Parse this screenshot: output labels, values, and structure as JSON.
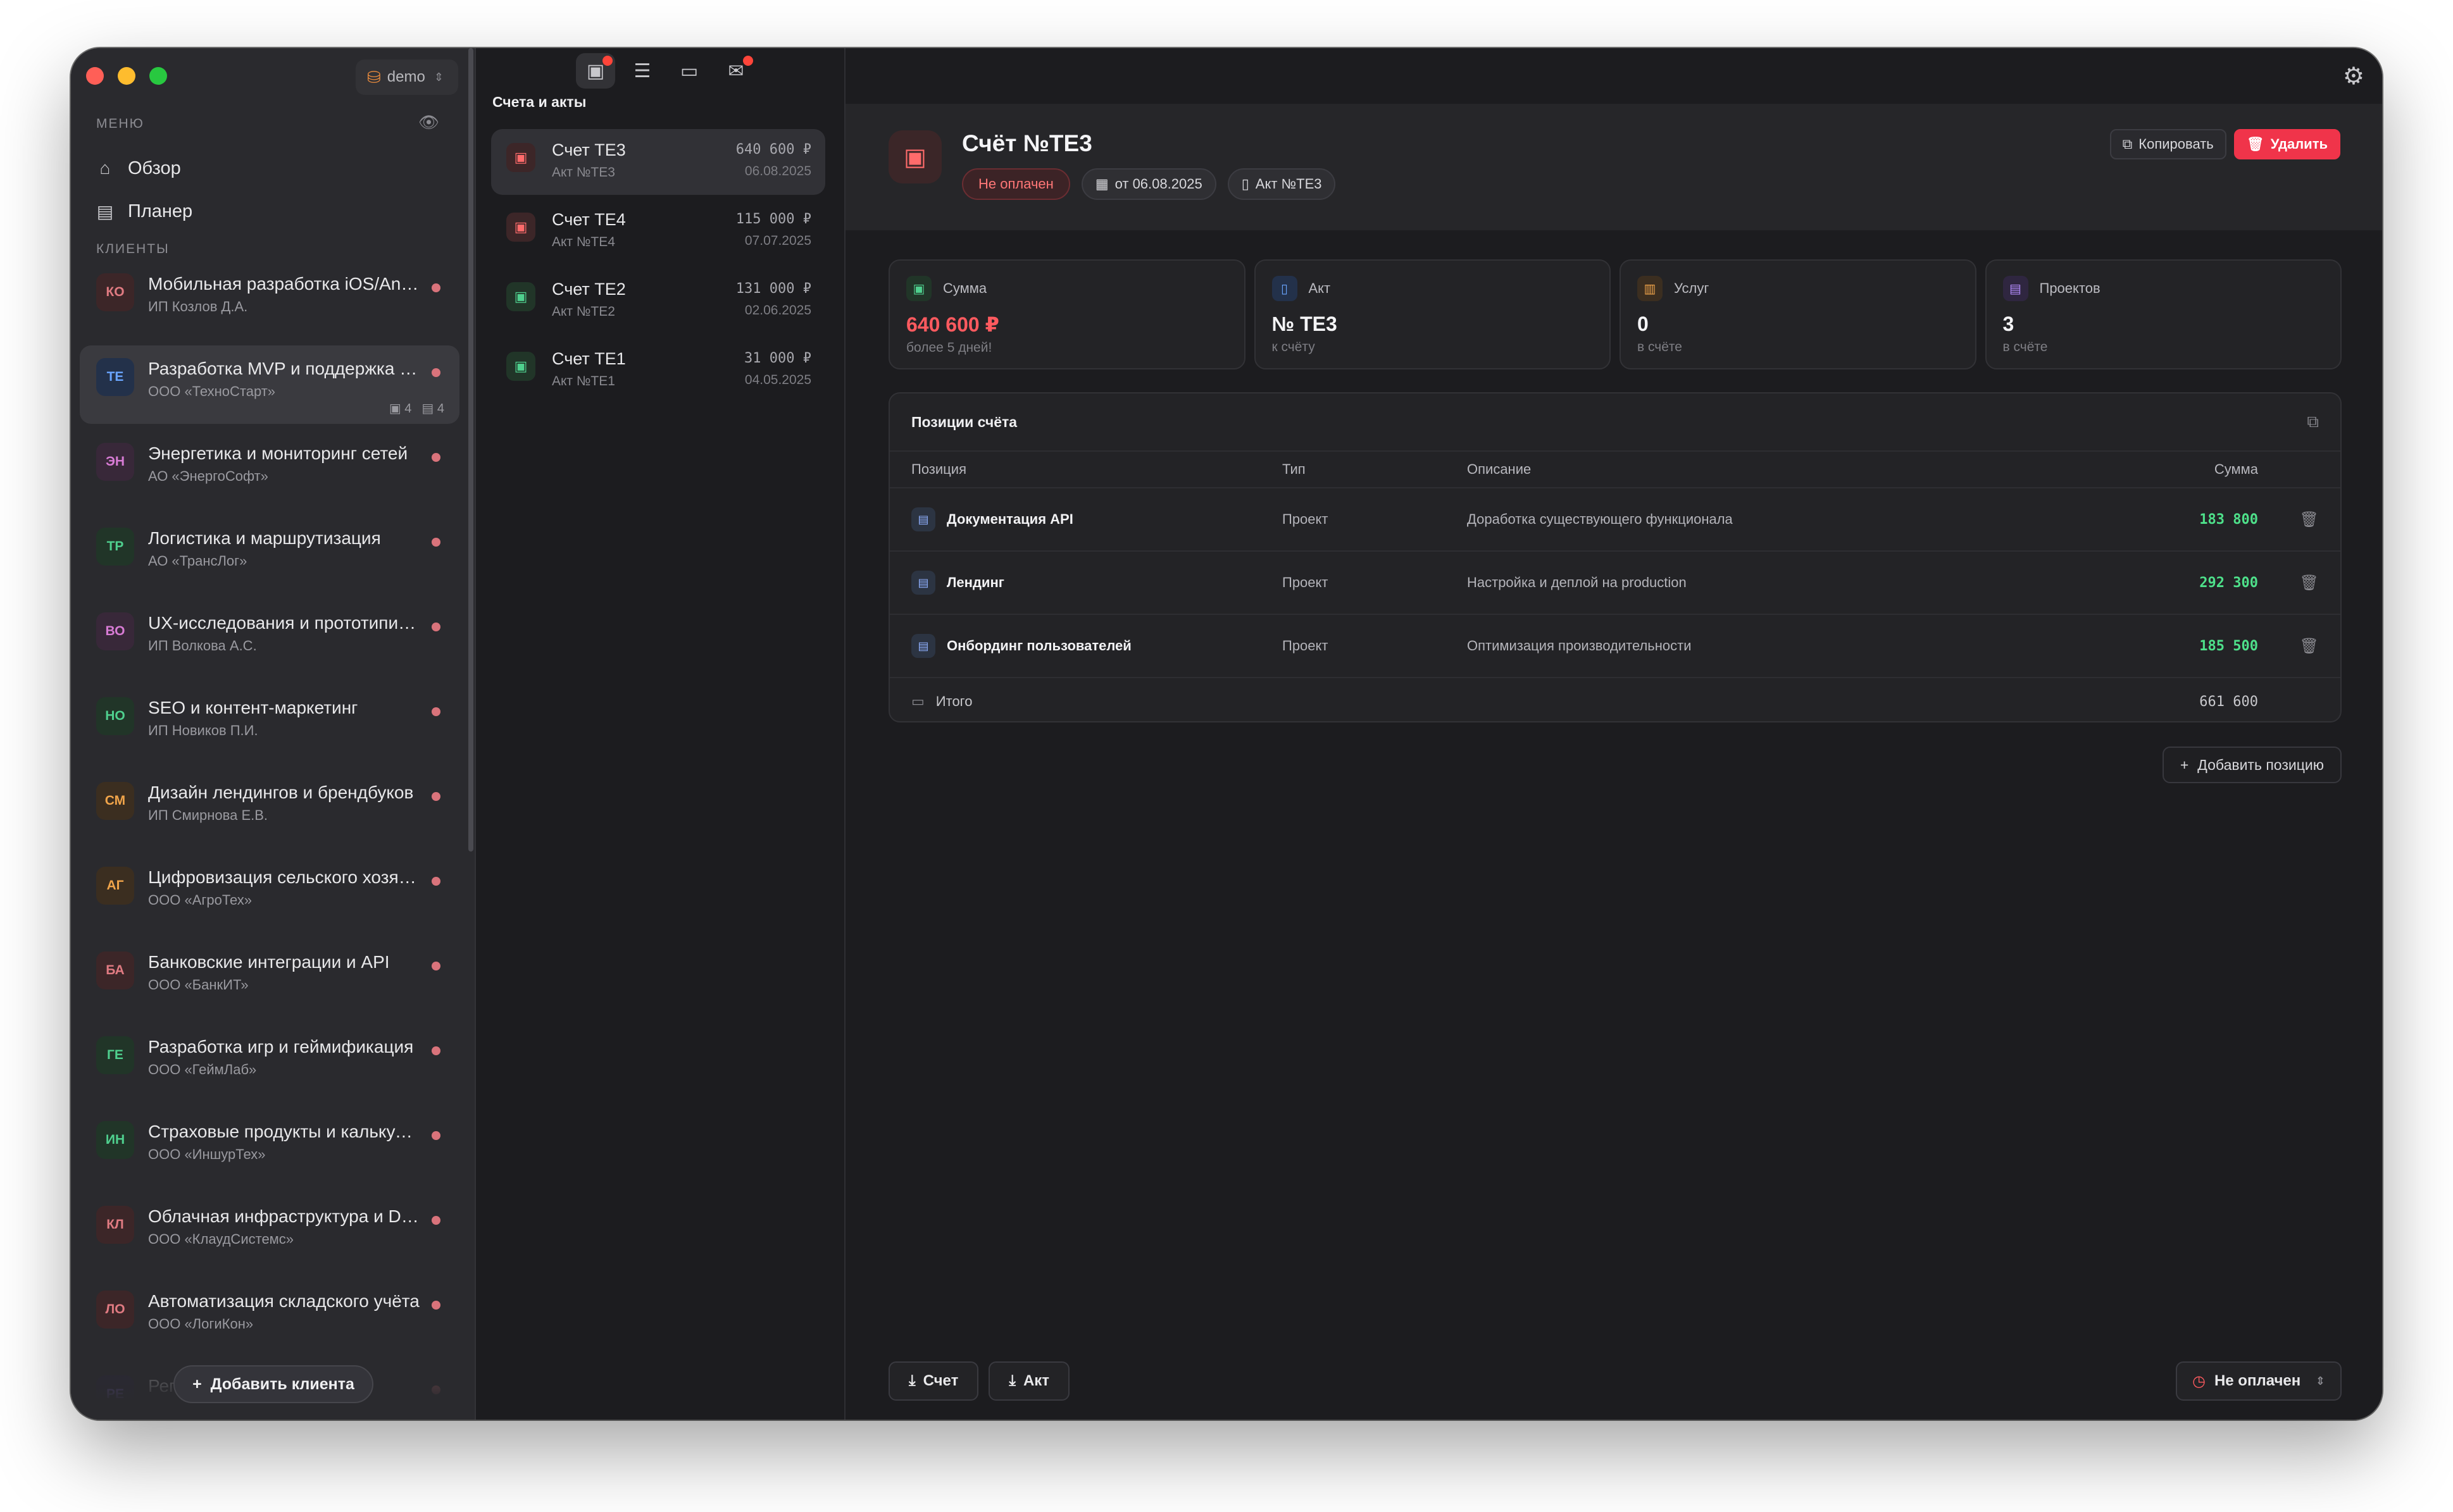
{
  "colors": {
    "accent_red": "#f0344a",
    "money_green": "#4ee08a",
    "dot": "#d9737b"
  },
  "sidebar": {
    "workspace": "demo",
    "menu_label": "МЕНЮ",
    "clients_label": "КЛИЕНТЫ",
    "nav": [
      {
        "label": "Обзор",
        "icon": "home-icon"
      },
      {
        "label": "Планер",
        "icon": "planner-icon"
      }
    ],
    "clients": [
      {
        "initials": "КО",
        "name": "Мобильная разработка iOS/Android",
        "org": "ИП Козлов Д.А.",
        "color": "#e07b82",
        "bg": "#3c2628"
      },
      {
        "initials": "ТЕ",
        "name": "Разработка MVP и поддержка платформы",
        "org": "ООО «ТехноСтарт»",
        "color": "#6aa5ff",
        "bg": "#23314a",
        "active": true,
        "invoices": "4",
        "projects": "4"
      },
      {
        "initials": "ЭН",
        "name": "Энергетика и мониторинг сетей",
        "org": "АО «ЭнергоСофт»",
        "color": "#d77bd4",
        "bg": "#382839"
      },
      {
        "initials": "ТР",
        "name": "Логистика и маршрутизация",
        "org": "АО «ТрансЛог»",
        "color": "#4fd08e",
        "bg": "#213528"
      },
      {
        "initials": "ВО",
        "name": "UX-исследования и прототипирование",
        "org": "ИП Волкова А.С.",
        "color": "#d77bd4",
        "bg": "#382839"
      },
      {
        "initials": "НО",
        "name": "SEO и контент-маркетинг",
        "org": "ИП Новиков П.И.",
        "color": "#4fd08e",
        "bg": "#213528"
      },
      {
        "initials": "СМ",
        "name": "Дизайн лендингов и брендбуков",
        "org": "ИП Смирнова Е.В.",
        "color": "#f0a44a",
        "bg": "#3b2e20"
      },
      {
        "initials": "АГ",
        "name": "Цифровизация сельского хозяйства",
        "org": "ООО «АгроТех»",
        "color": "#f0a44a",
        "bg": "#3b2e20"
      },
      {
        "initials": "БА",
        "name": "Банковские интеграции и API",
        "org": "ООО «БанкИТ»",
        "color": "#e07b82",
        "bg": "#3c2628"
      },
      {
        "initials": "ГЕ",
        "name": "Разработка игр и геймификация",
        "org": "ООО «ГеймЛаб»",
        "color": "#4fd08e",
        "bg": "#213528"
      },
      {
        "initials": "ИН",
        "name": "Страховые продукты и калькуляторы",
        "org": "ООО «ИншурТех»",
        "color": "#4fd08e",
        "bg": "#213528"
      },
      {
        "initials": "КЛ",
        "name": "Облачная инфраструктура и DevOps",
        "org": "ООО «КлаудСистемс»",
        "color": "#e07b82",
        "bg": "#3c2628"
      },
      {
        "initials": "ЛО",
        "name": "Автоматизация складского учёта",
        "org": "ООО «ЛогиКон»",
        "color": "#e07b82",
        "bg": "#3c2628"
      },
      {
        "initials": "РЕ",
        "name": "Региональная аналитика",
        "org": "",
        "color": "#9a7bff",
        "bg": "#2c2640"
      }
    ],
    "add_client": "Добавить клиента"
  },
  "list": {
    "title": "Счета и акты",
    "invoices": [
      {
        "name": "Счет ТЕ3",
        "act": "Акт №ТЕ3",
        "amount": "640 600 ₽",
        "date": "06.08.2025",
        "status": "unpaid",
        "active": true
      },
      {
        "name": "Счет ТЕ4",
        "act": "Акт №ТЕ4",
        "amount": "115 000 ₽",
        "date": "07.07.2025",
        "status": "unpaid"
      },
      {
        "name": "Счет ТЕ2",
        "act": "Акт №ТЕ2",
        "amount": "131 000 ₽",
        "date": "02.06.2025",
        "status": "paid"
      },
      {
        "name": "Счет ТЕ1",
        "act": "Акт №ТЕ1",
        "amount": "31 000 ₽",
        "date": "04.05.2025",
        "status": "paid"
      }
    ]
  },
  "detail": {
    "title": "Счёт №ТЕ3",
    "status": "Не оплачен",
    "date": "от 06.08.2025",
    "act": "Акт №ТЕ3",
    "copy": "Копировать",
    "delete": "Удалить",
    "stats": [
      {
        "label": "Сумма",
        "value": "640 600 ₽",
        "sub": "более 5 дней!",
        "red": true,
        "icon": "wallet-icon",
        "ic_color": "#4fd08e",
        "ic_bg": "#213528"
      },
      {
        "label": "Акт",
        "value": "№ ТЕ3",
        "sub": "к счёту",
        "icon": "document-icon",
        "ic_color": "#6aa5ff",
        "ic_bg": "#23314a"
      },
      {
        "label": "Услуг",
        "value": "0",
        "sub": "в счёте",
        "icon": "briefcase-icon",
        "ic_color": "#f0a44a",
        "ic_bg": "#3b2e20"
      },
      {
        "label": "Проектов",
        "value": "3",
        "sub": "в счёте",
        "icon": "folder-icon",
        "ic_color": "#b58cff",
        "ic_bg": "#2f2640"
      }
    ],
    "table": {
      "title": "Позиции счёта",
      "columns": {
        "pos": "Позиция",
        "type": "Тип",
        "desc": "Описание",
        "sum": "Сумма"
      },
      "rows": [
        {
          "name": "Документация API",
          "type": "Проект",
          "desc": "Доработка существующего функционала",
          "sum": "183 800"
        },
        {
          "name": "Лендинг",
          "type": "Проект",
          "desc": "Настройка и деплой на production",
          "sum": "292 300"
        },
        {
          "name": "Онбординг пользователей",
          "type": "Проект",
          "desc": "Оптимизация производительности",
          "sum": "185 500"
        }
      ],
      "total_label": "Итого",
      "total": "661 600"
    },
    "add_position": "Добавить позицию",
    "download_invoice": "Счет",
    "download_act": "Акт",
    "status_select": "Не оплачен"
  }
}
